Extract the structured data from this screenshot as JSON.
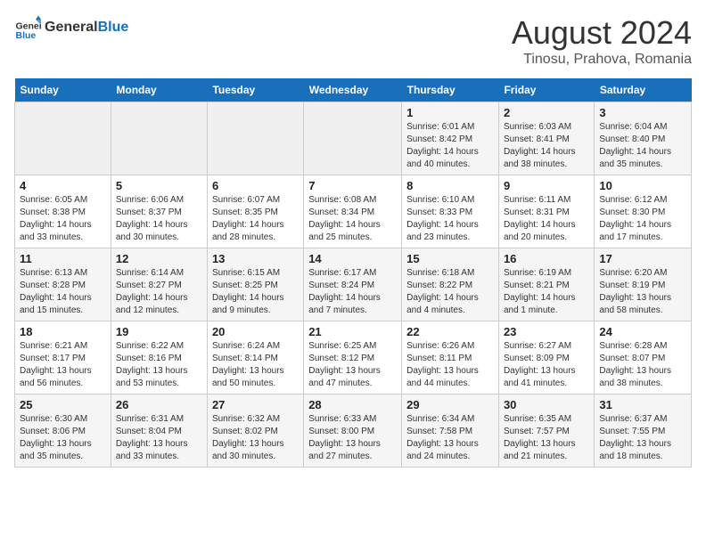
{
  "header": {
    "logo_line1": "General",
    "logo_line2": "Blue",
    "main_title": "August 2024",
    "subtitle": "Tinosu, Prahova, Romania"
  },
  "days_of_week": [
    "Sunday",
    "Monday",
    "Tuesday",
    "Wednesday",
    "Thursday",
    "Friday",
    "Saturday"
  ],
  "weeks": [
    [
      {
        "day": "",
        "info": ""
      },
      {
        "day": "",
        "info": ""
      },
      {
        "day": "",
        "info": ""
      },
      {
        "day": "",
        "info": ""
      },
      {
        "day": "1",
        "info": "Sunrise: 6:01 AM\nSunset: 8:42 PM\nDaylight: 14 hours\nand 40 minutes."
      },
      {
        "day": "2",
        "info": "Sunrise: 6:03 AM\nSunset: 8:41 PM\nDaylight: 14 hours\nand 38 minutes."
      },
      {
        "day": "3",
        "info": "Sunrise: 6:04 AM\nSunset: 8:40 PM\nDaylight: 14 hours\nand 35 minutes."
      }
    ],
    [
      {
        "day": "4",
        "info": "Sunrise: 6:05 AM\nSunset: 8:38 PM\nDaylight: 14 hours\nand 33 minutes."
      },
      {
        "day": "5",
        "info": "Sunrise: 6:06 AM\nSunset: 8:37 PM\nDaylight: 14 hours\nand 30 minutes."
      },
      {
        "day": "6",
        "info": "Sunrise: 6:07 AM\nSunset: 8:35 PM\nDaylight: 14 hours\nand 28 minutes."
      },
      {
        "day": "7",
        "info": "Sunrise: 6:08 AM\nSunset: 8:34 PM\nDaylight: 14 hours\nand 25 minutes."
      },
      {
        "day": "8",
        "info": "Sunrise: 6:10 AM\nSunset: 8:33 PM\nDaylight: 14 hours\nand 23 minutes."
      },
      {
        "day": "9",
        "info": "Sunrise: 6:11 AM\nSunset: 8:31 PM\nDaylight: 14 hours\nand 20 minutes."
      },
      {
        "day": "10",
        "info": "Sunrise: 6:12 AM\nSunset: 8:30 PM\nDaylight: 14 hours\nand 17 minutes."
      }
    ],
    [
      {
        "day": "11",
        "info": "Sunrise: 6:13 AM\nSunset: 8:28 PM\nDaylight: 14 hours\nand 15 minutes."
      },
      {
        "day": "12",
        "info": "Sunrise: 6:14 AM\nSunset: 8:27 PM\nDaylight: 14 hours\nand 12 minutes."
      },
      {
        "day": "13",
        "info": "Sunrise: 6:15 AM\nSunset: 8:25 PM\nDaylight: 14 hours\nand 9 minutes."
      },
      {
        "day": "14",
        "info": "Sunrise: 6:17 AM\nSunset: 8:24 PM\nDaylight: 14 hours\nand 7 minutes."
      },
      {
        "day": "15",
        "info": "Sunrise: 6:18 AM\nSunset: 8:22 PM\nDaylight: 14 hours\nand 4 minutes."
      },
      {
        "day": "16",
        "info": "Sunrise: 6:19 AM\nSunset: 8:21 PM\nDaylight: 14 hours\nand 1 minute."
      },
      {
        "day": "17",
        "info": "Sunrise: 6:20 AM\nSunset: 8:19 PM\nDaylight: 13 hours\nand 58 minutes."
      }
    ],
    [
      {
        "day": "18",
        "info": "Sunrise: 6:21 AM\nSunset: 8:17 PM\nDaylight: 13 hours\nand 56 minutes."
      },
      {
        "day": "19",
        "info": "Sunrise: 6:22 AM\nSunset: 8:16 PM\nDaylight: 13 hours\nand 53 minutes."
      },
      {
        "day": "20",
        "info": "Sunrise: 6:24 AM\nSunset: 8:14 PM\nDaylight: 13 hours\nand 50 minutes."
      },
      {
        "day": "21",
        "info": "Sunrise: 6:25 AM\nSunset: 8:12 PM\nDaylight: 13 hours\nand 47 minutes."
      },
      {
        "day": "22",
        "info": "Sunrise: 6:26 AM\nSunset: 8:11 PM\nDaylight: 13 hours\nand 44 minutes."
      },
      {
        "day": "23",
        "info": "Sunrise: 6:27 AM\nSunset: 8:09 PM\nDaylight: 13 hours\nand 41 minutes."
      },
      {
        "day": "24",
        "info": "Sunrise: 6:28 AM\nSunset: 8:07 PM\nDaylight: 13 hours\nand 38 minutes."
      }
    ],
    [
      {
        "day": "25",
        "info": "Sunrise: 6:30 AM\nSunset: 8:06 PM\nDaylight: 13 hours\nand 35 minutes."
      },
      {
        "day": "26",
        "info": "Sunrise: 6:31 AM\nSunset: 8:04 PM\nDaylight: 13 hours\nand 33 minutes."
      },
      {
        "day": "27",
        "info": "Sunrise: 6:32 AM\nSunset: 8:02 PM\nDaylight: 13 hours\nand 30 minutes."
      },
      {
        "day": "28",
        "info": "Sunrise: 6:33 AM\nSunset: 8:00 PM\nDaylight: 13 hours\nand 27 minutes."
      },
      {
        "day": "29",
        "info": "Sunrise: 6:34 AM\nSunset: 7:58 PM\nDaylight: 13 hours\nand 24 minutes."
      },
      {
        "day": "30",
        "info": "Sunrise: 6:35 AM\nSunset: 7:57 PM\nDaylight: 13 hours\nand 21 minutes."
      },
      {
        "day": "31",
        "info": "Sunrise: 6:37 AM\nSunset: 7:55 PM\nDaylight: 13 hours\nand 18 minutes."
      }
    ]
  ]
}
